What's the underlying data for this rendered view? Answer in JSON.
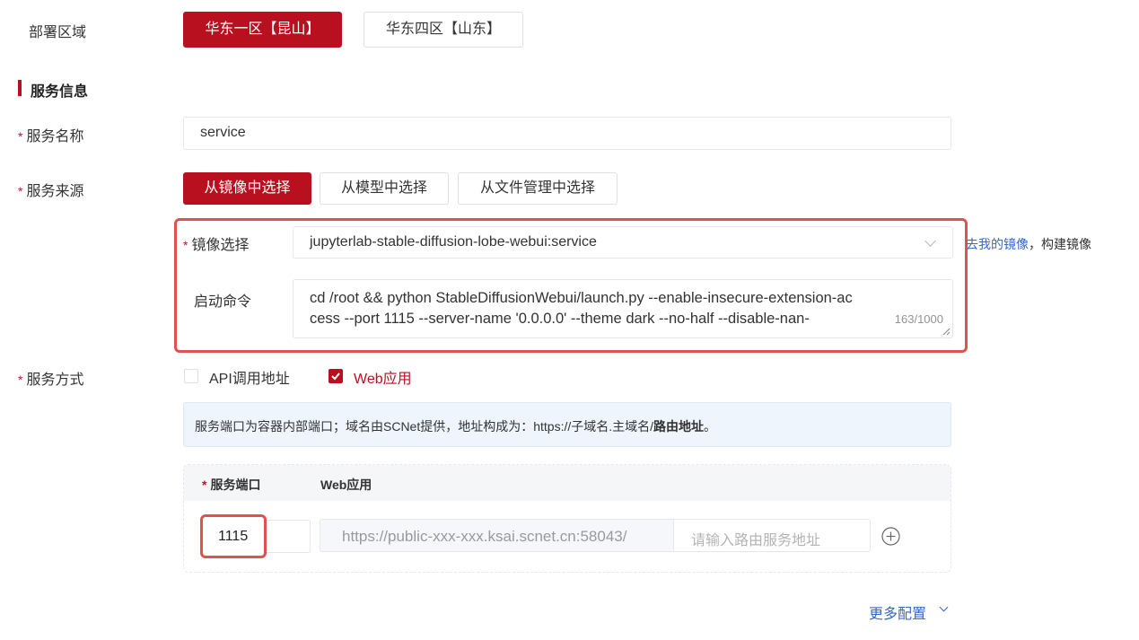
{
  "deploy": {
    "label": "部署区域",
    "options": [
      "华东一区【昆山】",
      "华东四区【山东】"
    ]
  },
  "section_title": "服务信息",
  "service_name": {
    "label": "服务名称",
    "value": "service"
  },
  "service_source": {
    "label": "服务来源",
    "tabs": [
      "从镜像中选择",
      "从模型中选择",
      "从文件管理中选择"
    ]
  },
  "image_select": {
    "label": "镜像选择",
    "value": "jupyterlab-stable-diffusion-lobe-webui:service",
    "side_link": "去我的镜像",
    "side_sep": "，",
    "side_text": "构建镜像"
  },
  "start_command": {
    "label": "启动命令",
    "line1": "cd /root && python StableDiffusionWebui/launch.py --enable-insecure-extension-ac",
    "line2": "cess --port 1115 --server-name '0.0.0.0' --theme dark --no-half --disable-nan-",
    "counter": "163/1000"
  },
  "service_mode": {
    "label": "服务方式",
    "options": [
      {
        "label": "API调用地址",
        "checked": false
      },
      {
        "label": "Web应用",
        "checked": true
      }
    ]
  },
  "info_box": {
    "text": "服务端口为容器内部端口；域名由SCNet提供，地址构成为：https://子域名.主域名/",
    "bold": "路由地址",
    "end": "。"
  },
  "port_table": {
    "col_port": "服务端口",
    "col_web": "Web应用",
    "port_value": "1115",
    "url_prefix": "https://public-xxx-xxx.ksai.scnet.cn:58043/",
    "route_placeholder": "请输入路由服务地址"
  },
  "more_config": "更多配置",
  "colors": {
    "primary": "#b8101f",
    "highlight": "#e0524f",
    "link": "#3a66c4",
    "info_bg": "#eef5fc"
  }
}
